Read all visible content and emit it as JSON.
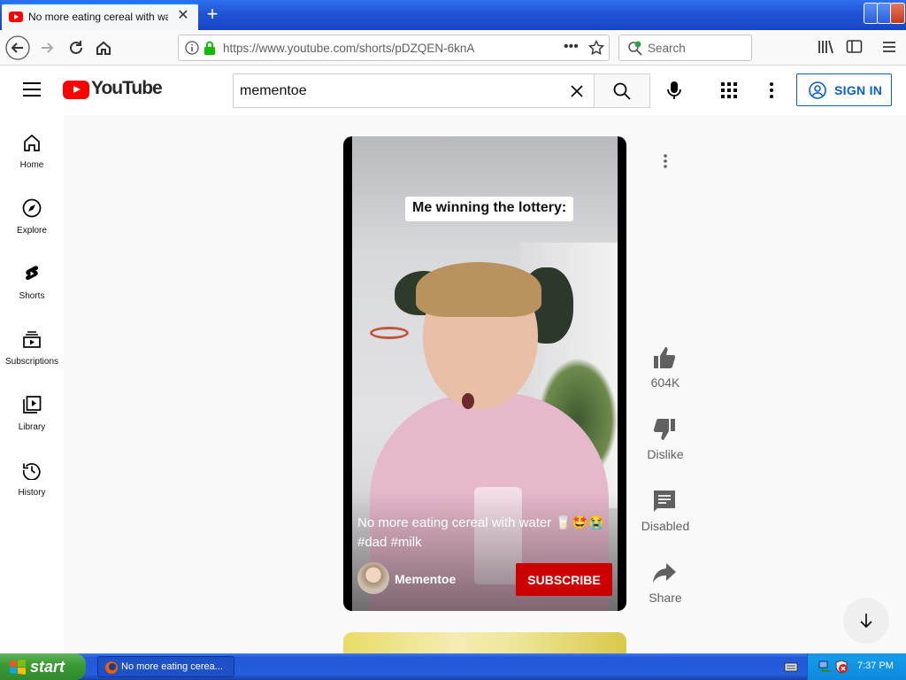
{
  "browser": {
    "tab_title": "No more eating cereal with water",
    "url": "https://www.youtube.com/shorts/pDZQEN-6knA",
    "search_placeholder": "Search"
  },
  "youtube": {
    "logo_text": "YouTube",
    "search_query": "mementoe",
    "signin_label": "SIGN IN",
    "guide": [
      {
        "label": "Home",
        "icon": "home-icon"
      },
      {
        "label": "Explore",
        "icon": "compass-icon"
      },
      {
        "label": "Shorts",
        "icon": "shorts-icon"
      },
      {
        "label": "Subscriptions",
        "icon": "subscriptions-icon"
      },
      {
        "label": "Library",
        "icon": "library-icon"
      },
      {
        "label": "History",
        "icon": "history-icon"
      }
    ],
    "short": {
      "overlay_caption": "Me winning the lottery:",
      "title": "No more eating cereal with water 🥛🤩😭 #dad #milk",
      "channel": "Mementoe",
      "subscribe_label": "SUBSCRIBE"
    },
    "actions": {
      "like_count": "604K",
      "dislike_label": "Dislike",
      "comments_label": "Disabled",
      "share_label": "Share"
    }
  },
  "taskbar": {
    "start_label": "start",
    "window_button": "No more eating cerea...",
    "clock": "7:37 PM"
  },
  "colors": {
    "youtube_red": "#ff0000",
    "subscribe_red": "#cc0000",
    "signin_blue": "#065fd4",
    "xp_blue": "#245edb"
  }
}
